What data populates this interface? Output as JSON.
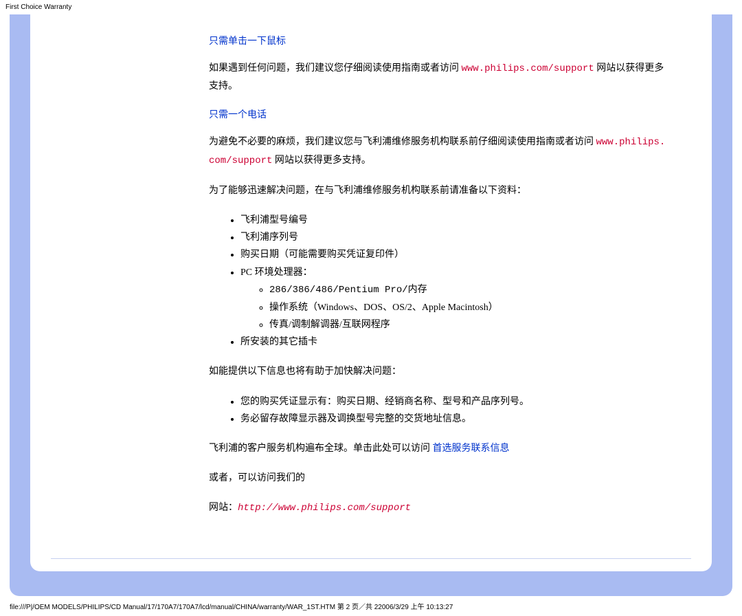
{
  "header": {
    "path": "First Choice Warranty"
  },
  "h1": "只需单击一下鼠标",
  "para1_a": "如果遇到任何问题，我们建议您仔细阅读使用指南或者访问 ",
  "para1_link": "www.philips.com/support",
  "para1_b": " 网站以获得更多支持。",
  "h2": "只需一个电话",
  "para2_a": "为避免不必要的麻烦，我们建议您与飞利浦维修服务机构联系前仔细阅读使用指南或者访问 ",
  "para2_link": "www.philips.com/support",
  "para2_b": " 网站以获得更多支持。",
  "para3": "为了能够迅速解决问题，在与飞利浦维修服务机构联系前请准备以下资料：",
  "list1": {
    "i0": "飞利浦型号编号",
    "i1": "飞利浦序列号",
    "i2": "购买日期（可能需要购买凭证复印件）",
    "i3": "PC 环境处理器：",
    "sub": {
      "s0": "286/386/486/Pentium Pro/内存",
      "s1": "操作系统（Windows、DOS、OS/2、Apple Macintosh）",
      "s2": "传真/调制解调器/互联网程序"
    },
    "i4": "所安装的其它插卡"
  },
  "para4": "如能提供以下信息也将有助于加快解决问题：",
  "list2": {
    "i0": "您的购买凭证显示有：购买日期、经销商名称、型号和产品序列号。",
    "i1": "务必留存故障显示器及调换型号完整的交货地址信息。"
  },
  "para5_a": "飞利浦的客户服务机构遍布全球。单击此处可以访问 ",
  "para5_link": "首选服务联系信息",
  "para6": "或者，可以访问我们的",
  "para7_a": "网站：",
  "para7_link": "http://www.philips.com/support",
  "footer": {
    "path": "file:///P|/OEM MODELS/PHILIPS/CD Manual/17/170A7/170A7/lcd/manual/CHINA/warranty/WAR_1ST.HTM 第 2 页／共 22006/3/29 上午 10:13:27"
  }
}
